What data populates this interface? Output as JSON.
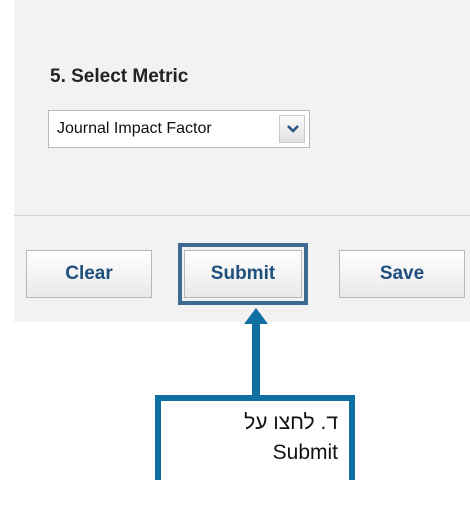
{
  "form": {
    "section_title": "5. Select Metric",
    "metric_select": {
      "selected_value": "Journal Impact Factor",
      "arrow_icon": "chevron-down-icon"
    },
    "buttons": {
      "clear_label": "Clear",
      "submit_label": "Submit",
      "save_label": "Save"
    }
  },
  "annotation": {
    "callout_line_1": "ד. לחצו על",
    "callout_line_2": "Submit",
    "highlight_target": "submit-button",
    "accent_color": "#3e6992",
    "arrow_color": "#0f6fa0"
  }
}
